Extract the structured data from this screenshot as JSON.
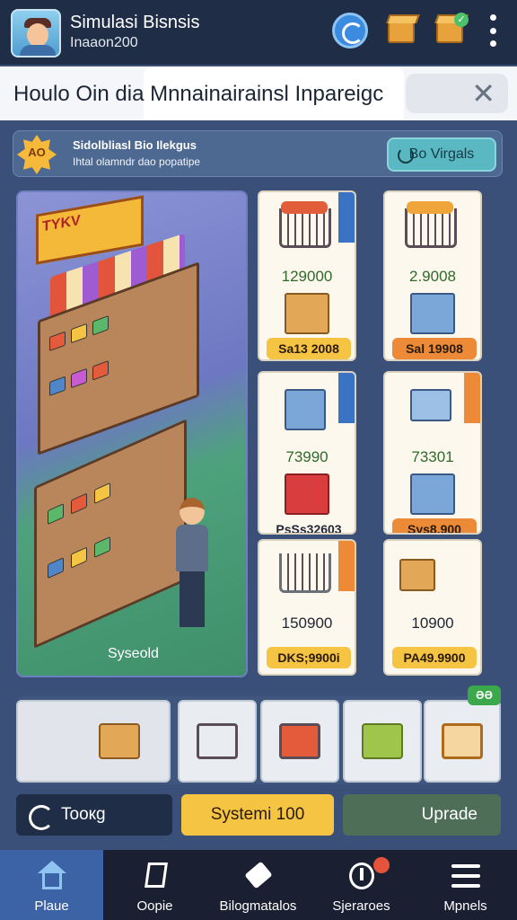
{
  "header": {
    "title": "Simulasi Bisnsis",
    "subtitle": "Inaaon200"
  },
  "banner": {
    "text": "Houlo Oin dia Mnnainairainsl Inpareigc",
    "close_label": "✕"
  },
  "quest": {
    "badge": "AO",
    "title": "Sidolbliasl Bio Ilekgus",
    "subtitle": "Ihtal olamndr dao popatipe",
    "button": "Bo Virgals"
  },
  "scene": {
    "sign_text": "TYKV",
    "label": "Syseold"
  },
  "shop_cards": [
    {
      "value": "129000",
      "price": "Sa13 2008",
      "price_style": "yellow"
    },
    {
      "value": "2.9008",
      "price": "Sal 19908",
      "price_style": "orange"
    },
    {
      "value": "73990",
      "price": "PsSs32603",
      "price_style": "none"
    },
    {
      "value": "73301",
      "price": "Sys8.900",
      "price_style": "orange"
    },
    {
      "value": "150900",
      "price": "DKS;9900i",
      "price_style": "yellow"
    },
    {
      "value": "10900",
      "price": "PA49.9900",
      "price_style": "yellow"
    }
  ],
  "tray": {
    "badge": "ƏƏ"
  },
  "actions": {
    "left": "Toокg",
    "center": "Systemi 100",
    "right": "Uprade"
  },
  "nav": [
    {
      "label": "Plaue",
      "icon": "home-icon"
    },
    {
      "label": "Oopie",
      "icon": "flag-icon"
    },
    {
      "label": "Bilogmatalos",
      "icon": "tag-icon"
    },
    {
      "label": "Sjeraroes",
      "icon": "shield-icon"
    },
    {
      "label": "Mpnels",
      "icon": "menu-icon"
    }
  ],
  "colors": {
    "background": "#3a5078",
    "topbar": "#1f2d47",
    "accent_yellow": "#f5c443",
    "accent_orange": "#ec8a38",
    "nav_active": "#3c63a6"
  }
}
